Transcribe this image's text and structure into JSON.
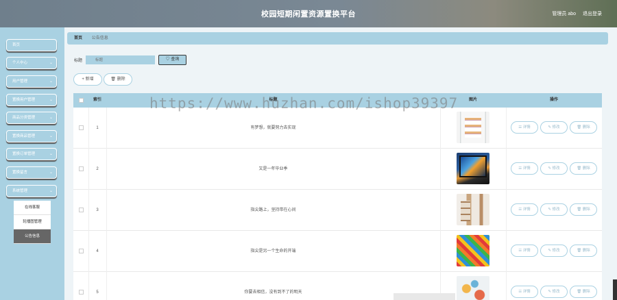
{
  "header": {
    "title": "校园短期闲置资源置换平台",
    "user": "管理员 abo",
    "logout": "退出登录"
  },
  "sidebar": {
    "items": [
      {
        "label": "首页",
        "chevron": ""
      },
      {
        "label": "个人中心",
        "chevron": "⌄"
      },
      {
        "label": "用户管理",
        "chevron": "⌄"
      },
      {
        "label": "置换用户管理",
        "chevron": "⌄"
      },
      {
        "label": "商品分类管理",
        "chevron": "⌄"
      },
      {
        "label": "置换商品管理",
        "chevron": "⌄"
      },
      {
        "label": "置换订单管理",
        "chevron": "⌄"
      },
      {
        "label": "置换留言",
        "chevron": "⌄"
      },
      {
        "label": "系统管理",
        "chevron": "⌄"
      }
    ],
    "submenu": [
      {
        "label": "在线客服",
        "active": false
      },
      {
        "label": "轮播图管理",
        "active": false
      },
      {
        "label": "公告信息",
        "active": true
      }
    ]
  },
  "breadcrumb": {
    "home": "首页",
    "current": "公告信息"
  },
  "search": {
    "label": "标题",
    "placeholder": "标题",
    "button": "♡ 查询"
  },
  "actions": {
    "add": "+ 新增",
    "delete": "🗑 删除"
  },
  "table": {
    "headers": {
      "index": "索引",
      "title": "标题",
      "image": "图片",
      "ops": "操作"
    },
    "rows": [
      {
        "index": "1",
        "title": "有梦想，就要努力去实现"
      },
      {
        "index": "2",
        "title": "又是一年毕业季"
      },
      {
        "index": "3",
        "title": "指尖路上，坚持带在心间"
      },
      {
        "index": "4",
        "title": "指尖是另一个生命的开端"
      },
      {
        "index": "5",
        "title": "你要去相信，没有到不了的明天"
      }
    ],
    "ops": {
      "detail": "☰ 详情",
      "edit": "✎ 修改",
      "del": "🗑 删除"
    }
  },
  "watermark": "https://www.huzhan.com/ishop39397",
  "colors": {
    "accent": "#a9d1e2",
    "header": "#7a8894"
  }
}
